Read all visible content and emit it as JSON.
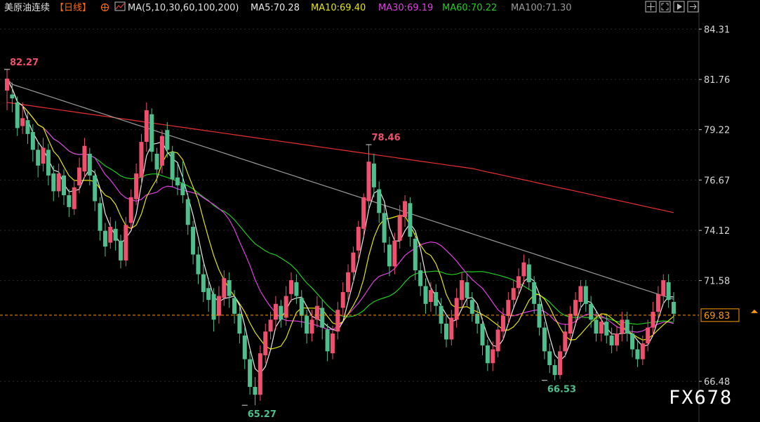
{
  "header": {
    "instrument": "美原油连续",
    "period": "【日线】",
    "ma_label": "MA(5,10,30,60,100,200)",
    "ma_values": [
      {
        "text": "MA5:70.28",
        "color": "#e8e8e8"
      },
      {
        "text": "MA10:69.40",
        "color": "#e6e600"
      },
      {
        "text": "MA30:69.19",
        "color": "#e040e0"
      },
      {
        "text": "MA60:70.22",
        "color": "#22cc22"
      },
      {
        "text": "MA100:71.30",
        "color": "#9a9a9a"
      }
    ]
  },
  "toolbar": {
    "icons": [
      "crosshair-icon",
      "expand-icon",
      "play-icon",
      "exit-icon"
    ]
  },
  "colors": {
    "up": "#f0506e",
    "down": "#4fc08d",
    "background": "#000000",
    "grid": "#2a2a2a",
    "price_line": "#ff9900",
    "ma5": "#e8e8e8",
    "ma10": "#e6e600",
    "ma30": "#e040e0",
    "ma60": "#22cc22",
    "ma100": "#9a9a9a",
    "ma200": "#e83030"
  },
  "watermark": "FX678",
  "chart_data": {
    "type": "candlestick",
    "y_ticks": [
      "84.31",
      "81.76",
      "79.22",
      "76.67",
      "74.12",
      "71.58",
      "66.48"
    ],
    "ylim": [
      64.6,
      85.0
    ],
    "current_price": "69.83",
    "annotations": [
      {
        "label": "82.27",
        "value": 82.27,
        "index": 0,
        "kind": "high"
      },
      {
        "label": "78.46",
        "value": 78.46,
        "index": 70,
        "kind": "high"
      },
      {
        "label": "65.27",
        "value": 65.27,
        "index": 46,
        "kind": "low"
      },
      {
        "label": "66.53",
        "value": 66.53,
        "index": 104,
        "kind": "low"
      }
    ],
    "candles": [
      [
        81.2,
        81.8,
        82.27,
        80.2
      ],
      [
        81.0,
        80.8,
        81.6,
        80.1
      ],
      [
        80.6,
        79.3,
        80.9,
        78.9
      ],
      [
        79.4,
        79.8,
        80.6,
        79.0
      ],
      [
        79.7,
        79.0,
        80.1,
        78.5
      ],
      [
        79.1,
        78.2,
        79.5,
        77.6
      ],
      [
        78.2,
        77.4,
        78.6,
        76.8
      ],
      [
        77.5,
        78.3,
        78.8,
        77.1
      ],
      [
        78.2,
        76.9,
        78.5,
        76.4
      ],
      [
        77.0,
        76.1,
        77.4,
        75.6
      ],
      [
        76.1,
        77.0,
        77.5,
        75.8
      ],
      [
        76.9,
        75.9,
        77.2,
        75.4
      ],
      [
        75.9,
        75.3,
        76.2,
        74.8
      ],
      [
        75.2,
        76.3,
        76.7,
        74.9
      ],
      [
        76.4,
        77.3,
        77.8,
        76.0
      ],
      [
        77.1,
        78.4,
        78.8,
        76.8
      ],
      [
        78.0,
        76.9,
        78.3,
        76.4
      ],
      [
        76.9,
        75.6,
        77.2,
        75.1
      ],
      [
        75.5,
        74.1,
        75.8,
        73.6
      ],
      [
        74.1,
        73.3,
        74.5,
        72.8
      ],
      [
        73.5,
        74.3,
        74.8,
        73.2
      ],
      [
        74.2,
        73.6,
        74.6,
        73.1
      ],
      [
        73.6,
        72.6,
        73.9,
        72.2
      ],
      [
        72.6,
        74.4,
        74.8,
        72.3
      ],
      [
        74.5,
        75.8,
        76.2,
        74.2
      ],
      [
        75.7,
        77.0,
        77.5,
        75.4
      ],
      [
        76.8,
        78.6,
        79.0,
        76.4
      ],
      [
        78.6,
        80.2,
        80.6,
        78.1
      ],
      [
        80.0,
        78.1,
        80.3,
        77.6
      ],
      [
        78.0,
        77.2,
        78.3,
        76.5
      ],
      [
        77.4,
        78.9,
        79.2,
        77.0
      ],
      [
        79.2,
        78.2,
        79.6,
        77.8
      ],
      [
        78.1,
        76.7,
        78.4,
        76.3
      ],
      [
        76.8,
        76.4,
        77.5,
        75.9
      ],
      [
        76.5,
        75.9,
        77.6,
        75.5
      ],
      [
        75.7,
        74.4,
        76.0,
        73.9
      ],
      [
        74.3,
        72.9,
        74.6,
        72.4
      ],
      [
        72.9,
        71.9,
        73.3,
        71.4
      ],
      [
        71.9,
        71.0,
        72.4,
        70.5
      ],
      [
        71.2,
        70.6,
        71.7,
        70.0
      ],
      [
        70.9,
        69.6,
        71.2,
        69.0
      ],
      [
        69.8,
        70.8,
        71.3,
        69.4
      ],
      [
        70.7,
        71.7,
        72.1,
        70.3
      ],
      [
        71.6,
        70.8,
        72.0,
        70.2
      ],
      [
        70.7,
        69.9,
        71.1,
        69.4
      ],
      [
        69.9,
        68.9,
        70.3,
        68.4
      ],
      [
        68.8,
        67.6,
        69.2,
        67.1
      ],
      [
        67.6,
        66.2,
        68.0,
        65.8
      ],
      [
        66.2,
        65.8,
        66.7,
        65.27
      ],
      [
        65.8,
        67.9,
        68.3,
        65.5
      ],
      [
        67.8,
        69.0,
        69.4,
        67.4
      ],
      [
        69.0,
        69.6,
        70.0,
        68.6
      ],
      [
        69.6,
        70.4,
        70.8,
        69.1
      ],
      [
        70.3,
        69.6,
        70.6,
        69.2
      ],
      [
        69.7,
        70.8,
        71.3,
        69.3
      ],
      [
        70.9,
        71.6,
        72.0,
        70.5
      ],
      [
        71.5,
        70.8,
        71.9,
        70.4
      ],
      [
        70.7,
        69.8,
        71.1,
        69.2
      ],
      [
        69.8,
        68.9,
        70.1,
        68.4
      ],
      [
        68.9,
        69.6,
        70.1,
        68.5
      ],
      [
        69.6,
        70.3,
        70.8,
        69.2
      ],
      [
        70.2,
        69.2,
        70.6,
        68.6
      ],
      [
        69.1,
        68.0,
        69.4,
        67.5
      ],
      [
        67.9,
        68.9,
        69.3,
        67.6
      ],
      [
        69.0,
        70.1,
        70.5,
        68.6
      ],
      [
        70.2,
        71.0,
        71.5,
        69.8
      ],
      [
        71.0,
        72.0,
        72.4,
        70.6
      ],
      [
        72.0,
        73.0,
        73.3,
        71.5
      ],
      [
        73.1,
        74.3,
        74.6,
        72.7
      ],
      [
        74.2,
        75.8,
        76.0,
        73.8
      ],
      [
        75.6,
        77.6,
        78.46,
        75.2
      ],
      [
        77.5,
        76.3,
        78.0,
        75.8
      ],
      [
        76.2,
        75.0,
        76.6,
        74.5
      ],
      [
        75.0,
        73.5,
        75.4,
        73.0
      ],
      [
        73.4,
        72.3,
        73.8,
        71.8
      ],
      [
        72.3,
        73.6,
        74.0,
        71.9
      ],
      [
        73.6,
        74.9,
        75.4,
        73.2
      ],
      [
        74.8,
        75.6,
        75.9,
        74.3
      ],
      [
        75.5,
        73.8,
        75.8,
        73.3
      ],
      [
        73.7,
        72.1,
        74.0,
        71.6
      ],
      [
        72.1,
        71.3,
        72.5,
        70.8
      ],
      [
        71.3,
        70.4,
        71.7,
        69.9
      ],
      [
        70.5,
        71.1,
        71.5,
        70.0
      ],
      [
        71.0,
        70.3,
        71.4,
        69.8
      ],
      [
        70.3,
        69.4,
        70.7,
        68.9
      ],
      [
        69.4,
        68.6,
        69.8,
        68.2
      ],
      [
        68.6,
        69.7,
        70.1,
        68.3
      ],
      [
        69.6,
        70.7,
        71.2,
        69.2
      ],
      [
        70.6,
        71.6,
        72.0,
        70.2
      ],
      [
        71.5,
        70.7,
        71.9,
        70.3
      ],
      [
        70.6,
        69.9,
        71.0,
        69.5
      ],
      [
        69.9,
        69.4,
        70.3,
        68.9
      ],
      [
        69.4,
        68.3,
        69.7,
        67.8
      ],
      [
        68.3,
        67.4,
        68.6,
        67.0
      ],
      [
        67.4,
        68.1,
        68.5,
        67.0
      ],
      [
        68.0,
        69.1,
        69.5,
        67.7
      ],
      [
        69.0,
        69.8,
        70.2,
        68.6
      ],
      [
        69.8,
        70.6,
        71.0,
        69.4
      ],
      [
        70.6,
        71.2,
        71.6,
        70.2
      ],
      [
        71.2,
        71.8,
        72.2,
        70.8
      ],
      [
        71.8,
        72.5,
        72.9,
        71.4
      ],
      [
        72.4,
        71.5,
        72.7,
        71.1
      ],
      [
        71.5,
        70.4,
        71.8,
        69.9
      ],
      [
        70.4,
        69.2,
        70.7,
        68.8
      ],
      [
        69.2,
        68.0,
        69.5,
        67.6
      ],
      [
        68.0,
        67.3,
        68.4,
        66.9
      ],
      [
        67.3,
        66.8,
        67.6,
        66.53
      ],
      [
        66.8,
        68.0,
        68.3,
        66.6
      ],
      [
        68.0,
        69.0,
        69.4,
        67.7
      ],
      [
        68.9,
        69.9,
        70.3,
        68.6
      ],
      [
        69.8,
        70.6,
        71.0,
        69.4
      ],
      [
        70.5,
        71.3,
        71.6,
        70.1
      ],
      [
        71.3,
        70.4,
        71.6,
        70.0
      ],
      [
        70.4,
        69.6,
        70.8,
        69.2
      ],
      [
        69.6,
        68.9,
        70.0,
        68.5
      ],
      [
        68.9,
        69.5,
        69.9,
        68.5
      ],
      [
        69.5,
        68.8,
        69.9,
        68.4
      ],
      [
        68.8,
        68.3,
        69.2,
        67.9
      ],
      [
        68.3,
        68.9,
        69.3,
        68.0
      ],
      [
        68.9,
        69.6,
        70.0,
        68.5
      ],
      [
        69.6,
        68.9,
        70.0,
        68.5
      ],
      [
        68.9,
        68.1,
        69.3,
        67.7
      ],
      [
        68.1,
        67.6,
        68.5,
        67.2
      ],
      [
        67.6,
        68.4,
        68.8,
        67.3
      ],
      [
        68.4,
        69.2,
        69.6,
        68.0
      ],
      [
        69.2,
        70.0,
        70.5,
        68.8
      ],
      [
        70.0,
        70.9,
        71.3,
        69.6
      ],
      [
        70.8,
        71.6,
        71.9,
        70.4
      ],
      [
        71.5,
        70.6,
        71.9,
        70.2
      ],
      [
        70.5,
        69.9,
        71.0,
        69.5
      ]
    ]
  }
}
